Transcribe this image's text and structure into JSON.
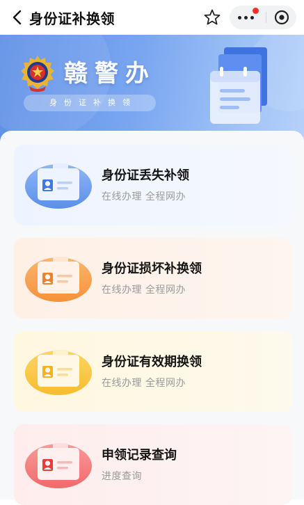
{
  "navbar": {
    "title": "身份证补换领",
    "icons": [
      "back-arrow-icon",
      "star-icon",
      "more-dots-icon",
      "target-icon"
    ]
  },
  "banner": {
    "brand": "赣警办",
    "subtitle": "身份证补换领",
    "icons": [
      "police-emblem-icon",
      "calendar-icon"
    ]
  },
  "services": [
    {
      "title": "身份证丢失补领",
      "subtitle": "在线办理 全程网办",
      "theme": "blue",
      "icon": "id-card-icon"
    },
    {
      "title": "身份证损坏补换领",
      "subtitle": "在线办理 全程网办",
      "theme": "orange",
      "icon": "id-card-icon"
    },
    {
      "title": "身份证有效期换领",
      "subtitle": "在线办理 全程网办",
      "theme": "yellow",
      "icon": "id-card-icon"
    },
    {
      "title": "申领记录查询",
      "subtitle": "进度查询",
      "theme": "red",
      "icon": "id-card-icon"
    }
  ],
  "colors": {
    "blue": "#5b8fe9",
    "orange": "#f6923a",
    "yellow": "#f8c23a",
    "red": "#f26a6a",
    "notify": "#f4302b"
  }
}
